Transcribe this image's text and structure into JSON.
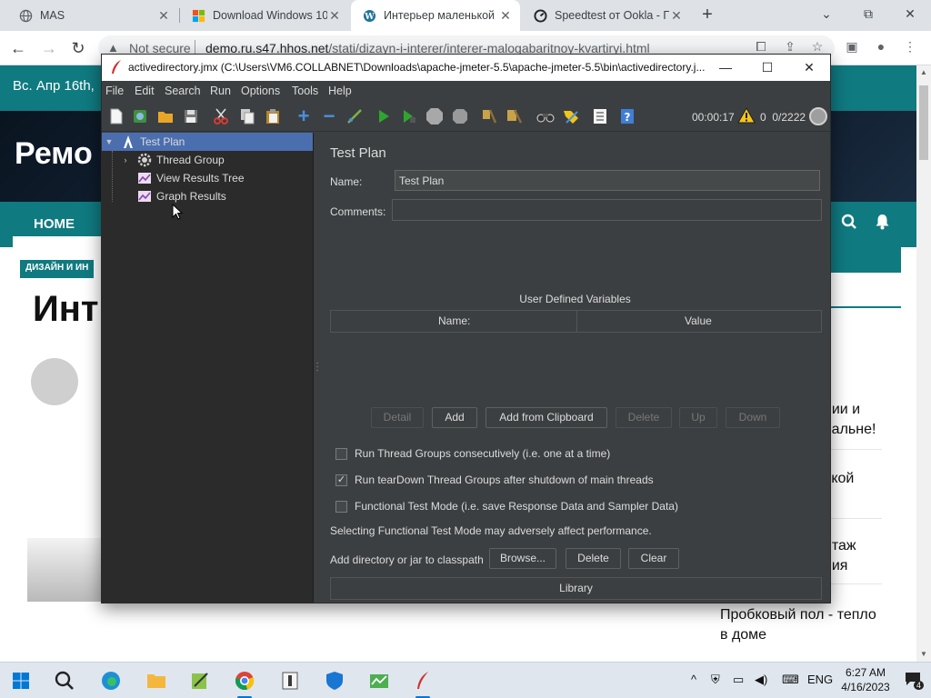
{
  "browser": {
    "tabs": [
      {
        "title": "MAS",
        "icon": "globe-icon",
        "active": false
      },
      {
        "title": "Download Windows 10",
        "icon": "windows-logo-icon",
        "active": false
      },
      {
        "title": "Интерьер маленькой",
        "icon": "wordpress-icon",
        "active": true
      },
      {
        "title": "Speedtest от Ookla - Г",
        "icon": "speedtest-icon",
        "active": false
      }
    ],
    "security_label": "Not secure",
    "url_host": "demo.ru.s47.hhos.net",
    "url_path": "/stati/dizayn-i-interer/interer-malogabaritnoy-kvartiryi.html"
  },
  "webpage": {
    "date": "Вс. Апр 16th,",
    "logo": "Ремо",
    "nav_home": "HOME",
    "badge": "ДИЗАЙН И ИН",
    "headline": "Инт",
    "sidebar": [
      {
        "lines": [
          "нии и",
          "пальне!"
        ]
      },
      {
        "lines": [
          "ькой"
        ]
      },
      {
        "lines": [
          "нтаж",
          "ния"
        ]
      },
      {
        "lines": [
          "Пробковый пол - тепло",
          "в доме"
        ]
      }
    ]
  },
  "jmeter": {
    "title": "activedirectory.jmx (C:\\Users\\VM6.COLLABNET\\Downloads\\apache-jmeter-5.5\\apache-jmeter-5.5\\bin\\activedirectory.j...",
    "menu": [
      "File",
      "Edit",
      "Search",
      "Run",
      "Options",
      "Tools",
      "Help"
    ],
    "timer": "00:00:17",
    "warnings": "0",
    "threads": "0/2222",
    "tree": [
      {
        "label": "Test Plan",
        "icon": "test-plan-icon",
        "selected": true
      },
      {
        "label": "Thread Group",
        "icon": "gear-icon",
        "selected": false
      },
      {
        "label": "View Results Tree",
        "icon": "graph-icon",
        "selected": false
      },
      {
        "label": "Graph Results",
        "icon": "graph-icon",
        "selected": false
      }
    ],
    "panel": {
      "title": "Test Plan",
      "name_label": "Name:",
      "name_value": "Test Plan",
      "comments_label": "Comments:",
      "comments_value": "",
      "udv_title": "User Defined Variables",
      "col_name": "Name:",
      "col_value": "Value",
      "buttons": {
        "detail": "Detail",
        "add": "Add",
        "add_clipboard": "Add from Clipboard",
        "delete": "Delete",
        "up": "Up",
        "down": "Down"
      },
      "checkboxes": [
        {
          "label": "Run Thread Groups consecutively (i.e. one at a time)",
          "checked": false
        },
        {
          "label": "Run tearDown Thread Groups after shutdown of main threads",
          "checked": true
        },
        {
          "label": "Functional Test Mode (i.e. save Response Data and Sampler Data)",
          "checked": false
        }
      ],
      "note": "Selecting Functional Test Mode may adversely affect performance.",
      "classpath_label": "Add directory or jar to classpath",
      "browse": "Browse...",
      "cp_delete": "Delete",
      "clear": "Clear",
      "library": "Library"
    }
  },
  "taskbar": {
    "lang": "ENG",
    "time": "6:27 AM",
    "date": "4/16/2023",
    "notifications": "4"
  },
  "colors": {
    "accent_teal": "#0f7a80",
    "jmeter_bg": "#3c3f41",
    "selection": "#4b6eaf"
  }
}
